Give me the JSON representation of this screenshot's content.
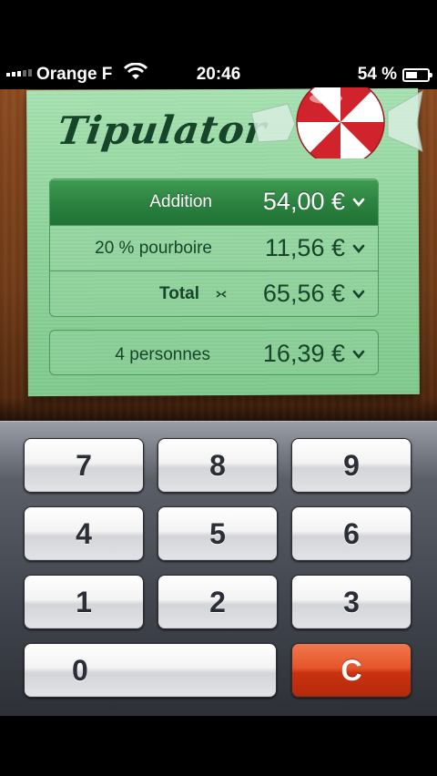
{
  "status_bar": {
    "carrier": "Orange F",
    "time": "20:46",
    "battery": "54 %"
  },
  "app": {
    "title": "Tipulator"
  },
  "rows": [
    {
      "label": "Addition",
      "value": "54,00 €"
    },
    {
      "label": "20 % pourboire",
      "value": "11,56 €"
    },
    {
      "label": "Total",
      "value": "65,56 €"
    }
  ],
  "split": {
    "label": "4 personnes",
    "value": "16,39 €"
  },
  "keypad": {
    "keys": [
      "7",
      "8",
      "9",
      "4",
      "5",
      "6",
      "1",
      "2",
      "3"
    ],
    "zero": "0",
    "clear": "C"
  },
  "colors": {
    "paper": "#8fd49c",
    "selected_row": "#2c8340",
    "clear_key": "#e5562a"
  }
}
